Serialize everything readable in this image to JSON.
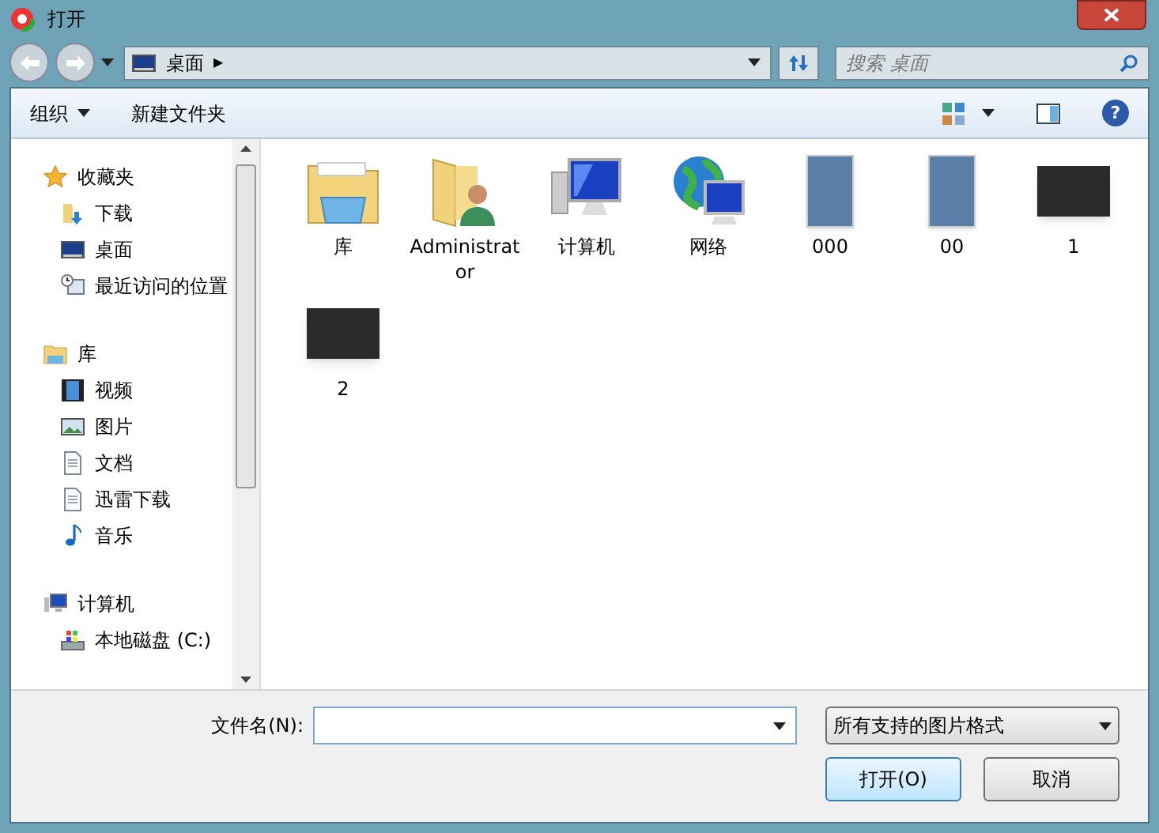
{
  "window": {
    "title": "打开"
  },
  "address": {
    "location": "桌面",
    "separator": "▶"
  },
  "search": {
    "placeholder": "搜索 桌面"
  },
  "toolbar": {
    "organize": "组织",
    "new_folder": "新建文件夹",
    "help": "?"
  },
  "sidebar": {
    "groups": [
      {
        "label": "收藏夹",
        "kind": "favorites",
        "children": [
          {
            "label": "下载",
            "kind": "download"
          },
          {
            "label": "桌面",
            "kind": "desktop"
          },
          {
            "label": "最近访问的位置",
            "kind": "recent"
          }
        ]
      },
      {
        "label": "库",
        "kind": "library",
        "children": [
          {
            "label": "视频",
            "kind": "video"
          },
          {
            "label": "图片",
            "kind": "picture"
          },
          {
            "label": "文档",
            "kind": "document"
          },
          {
            "label": "迅雷下载",
            "kind": "document"
          },
          {
            "label": "音乐",
            "kind": "music"
          }
        ]
      },
      {
        "label": "计算机",
        "kind": "computer",
        "children": [
          {
            "label": "本地磁盘 (C:)",
            "kind": "disk"
          }
        ]
      }
    ]
  },
  "files": [
    {
      "name": "库",
      "kind": "library"
    },
    {
      "name": "Administrator",
      "kind": "user"
    },
    {
      "name": "计算机",
      "kind": "computer"
    },
    {
      "name": "网络",
      "kind": "network"
    },
    {
      "name": "000",
      "kind": "photo"
    },
    {
      "name": "00",
      "kind": "photo"
    },
    {
      "name": "1",
      "kind": "screenshot"
    },
    {
      "name": "2",
      "kind": "screenshot"
    }
  ],
  "bottom": {
    "filename_label": "文件名(N):",
    "file_type": "所有支持的图片格式",
    "open_button": "打开(O)",
    "cancel_button": "取消"
  }
}
